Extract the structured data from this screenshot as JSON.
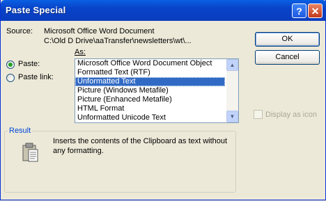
{
  "window": {
    "title": "Paste Special",
    "help_glyph": "?",
    "close_glyph": "✕"
  },
  "source": {
    "label": "Source:",
    "line1": "Microsoft Office Word Document",
    "line2": "C:\\Old D Drive\\aaTransfer\\newsletters\\wt\\..."
  },
  "as_label": "As:",
  "options": [
    {
      "label": "Paste:",
      "checked": true
    },
    {
      "label": "Paste link:",
      "checked": false
    }
  ],
  "formats": [
    "Microsoft Office Word Document Object",
    "Formatted Text (RTF)",
    "Unformatted Text",
    "Picture (Windows Metafile)",
    "Picture (Enhanced Metafile)",
    "HTML Format",
    "Unformatted Unicode Text"
  ],
  "selected_format": "Unformatted Text",
  "buttons": {
    "ok": "OK",
    "cancel": "Cancel"
  },
  "display_as_icon": {
    "label": "Display as icon",
    "checked": false,
    "enabled": false
  },
  "result": {
    "legend": "Result",
    "line1": "Inserts the contents of the Clipboard as text without",
    "line2": "any formatting."
  },
  "colors": {
    "titlebar": "#0a5fe3",
    "selection": "#316ac5",
    "legend": "#0046d5"
  }
}
